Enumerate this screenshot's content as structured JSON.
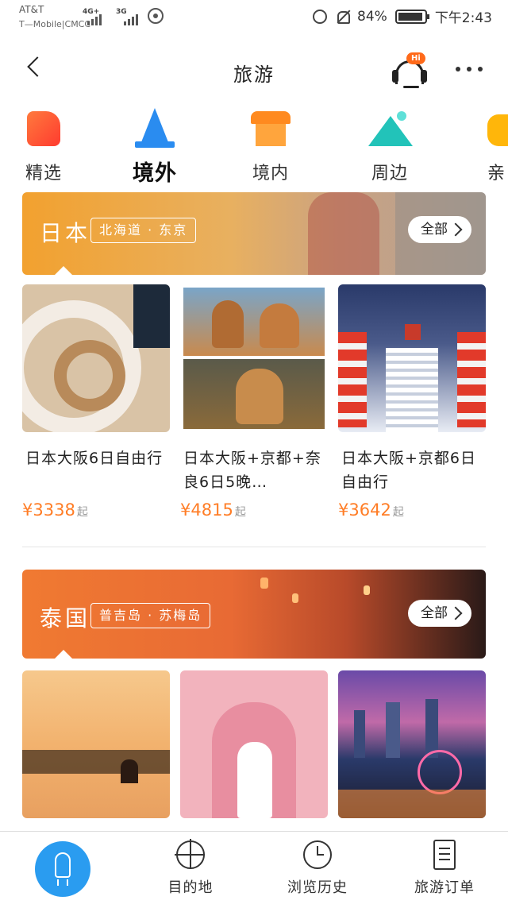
{
  "status_bar": {
    "carrier_1": "AT&T",
    "carrier_2": "T—Mobile|CMCC",
    "sig_1": "4G+",
    "sig_2": "3G",
    "battery": "84%",
    "time": "下午2:43"
  },
  "header": {
    "title": "旅游",
    "service_badge": "Hi"
  },
  "categories": [
    {
      "label": "精选",
      "icon": "thumbs-up-icon",
      "active": false
    },
    {
      "label": "境外",
      "icon": "eiffel-tower-icon",
      "active": true
    },
    {
      "label": "境内",
      "icon": "temple-icon",
      "active": false
    },
    {
      "label": "周边",
      "icon": "mountain-icon",
      "active": false
    },
    {
      "label": "亲",
      "icon": "partial-icon",
      "active": false
    }
  ],
  "sections": [
    {
      "country": "日本",
      "places": "北海道 · 东京",
      "all_label": "全部",
      "products": [
        {
          "name": "日本大阪6日自由行",
          "price": "¥3338",
          "suffix": "起"
        },
        {
          "name": "日本大阪+京都+奈良6日5晚…",
          "price": "¥4815",
          "suffix": "起"
        },
        {
          "name": "日本大阪+京都6日自由行",
          "price": "¥3642",
          "suffix": "起"
        }
      ]
    },
    {
      "country": "泰国",
      "places": "普吉岛 · 苏梅岛",
      "all_label": "全部"
    }
  ],
  "bottom_nav": [
    {
      "label": "",
      "icon": "rocket-icon"
    },
    {
      "label": "目的地",
      "icon": "target-icon"
    },
    {
      "label": "浏览历史",
      "icon": "clock-icon"
    },
    {
      "label": "旅游订单",
      "icon": "document-icon"
    }
  ],
  "colors": {
    "accent_orange": "#ff7d26",
    "japan_banner": "#f3a73a",
    "thailand_banner": "#f07a32",
    "nav_blue": "#2a9cf0"
  }
}
